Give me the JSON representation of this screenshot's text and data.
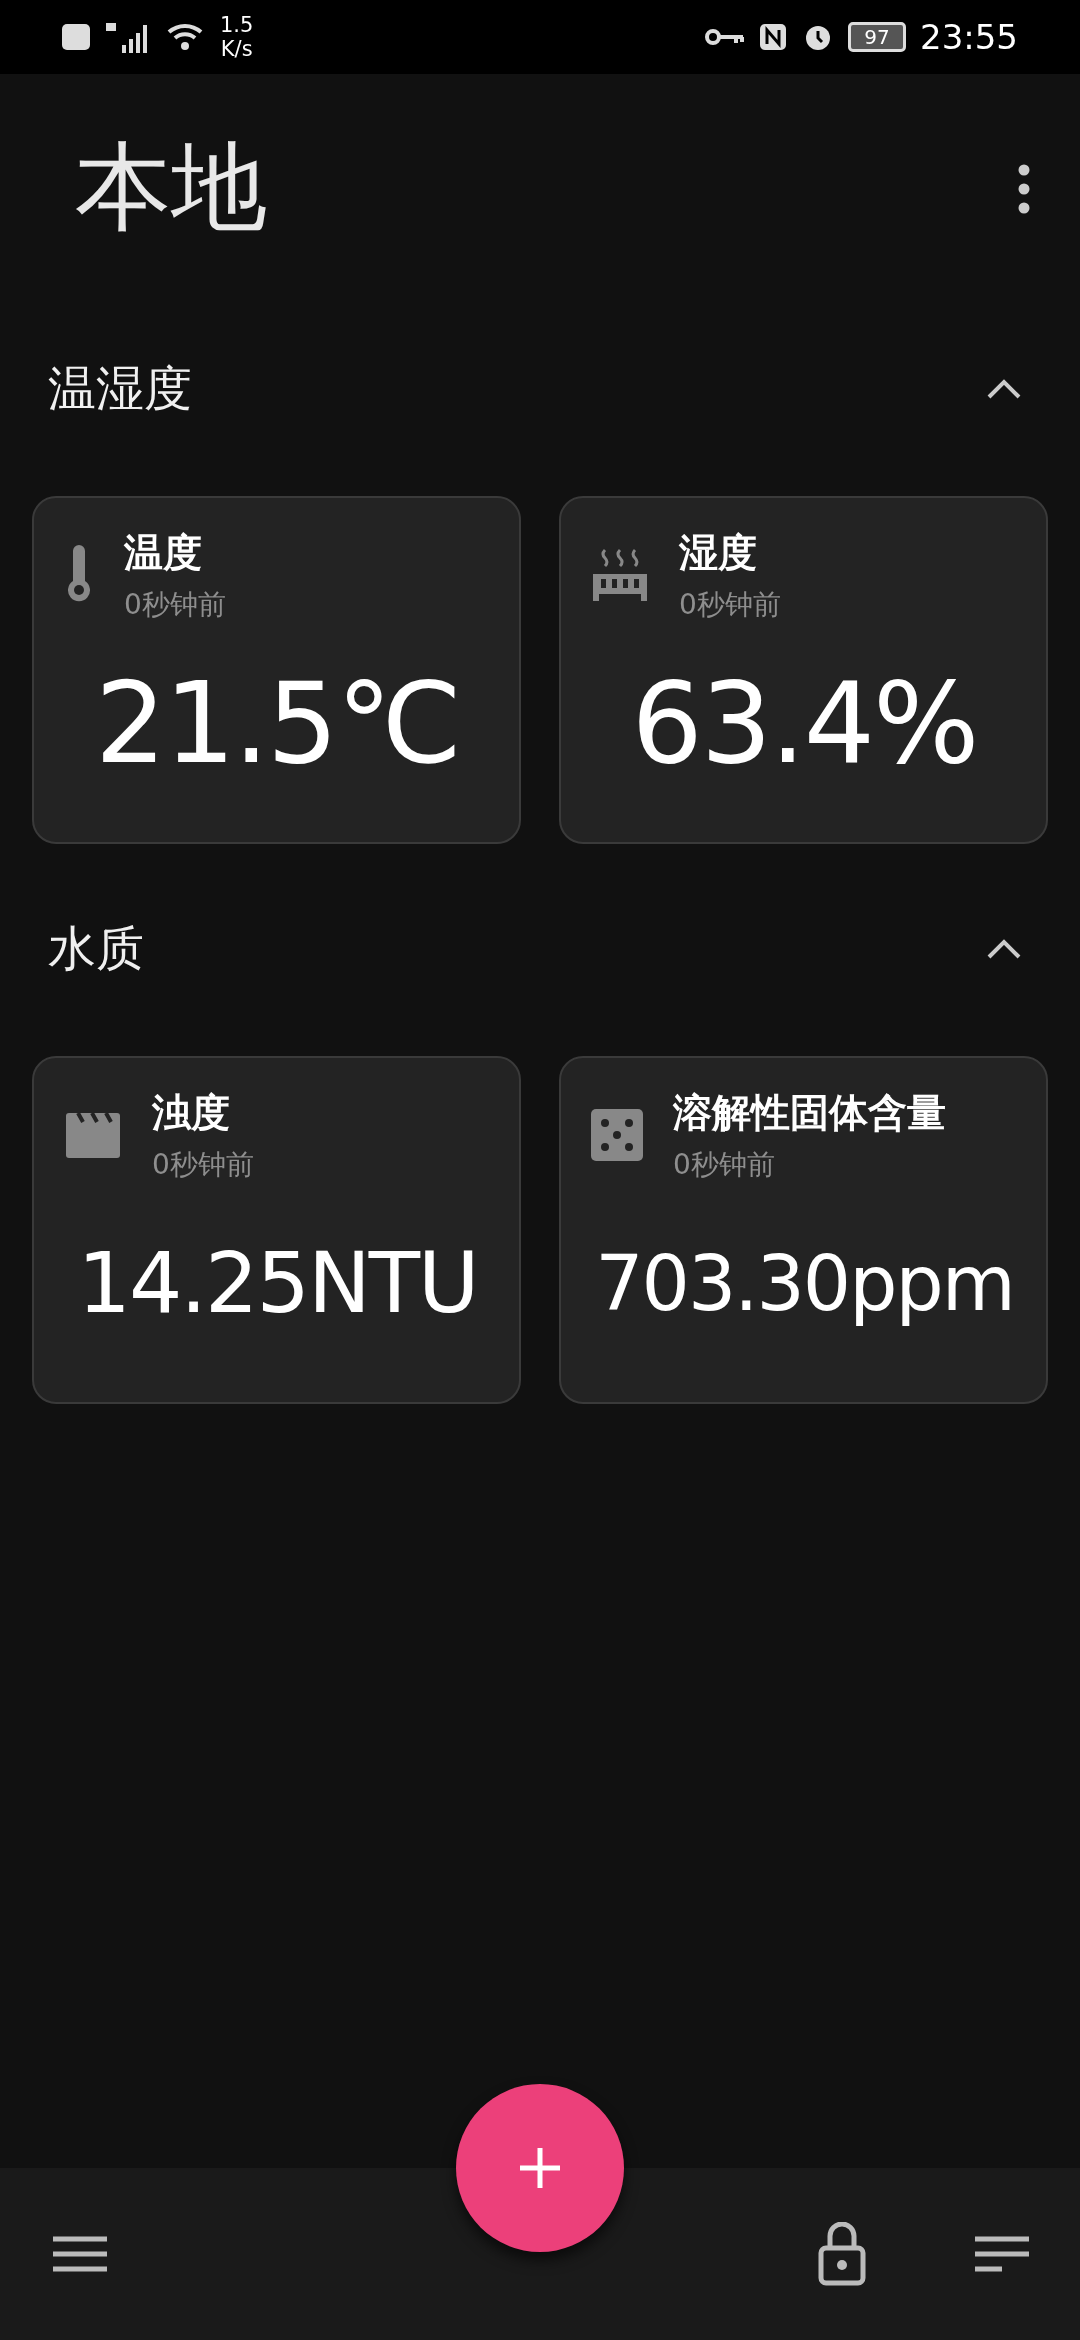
{
  "status_bar": {
    "network_speed": [
      "1.5",
      "K/s"
    ],
    "battery": "97",
    "time": "23:55"
  },
  "header": {
    "title": "本地"
  },
  "sections": [
    {
      "title": "温湿度",
      "expanded": true,
      "cards": [
        {
          "name": "温度",
          "updated": "0秒钟前",
          "value": "21.5℃"
        },
        {
          "name": "湿度",
          "updated": "0秒钟前",
          "value": "63.4%"
        }
      ]
    },
    {
      "title": "水质",
      "expanded": true,
      "cards": [
        {
          "name": "浊度",
          "updated": "0秒钟前",
          "value": "14.25NTU"
        },
        {
          "name": "溶解性固体含量",
          "updated": "0秒钟前",
          "value": "703.30ppm"
        }
      ]
    }
  ]
}
